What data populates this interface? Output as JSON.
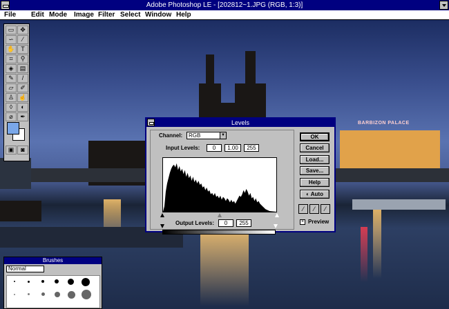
{
  "window": {
    "title": "Adobe Photoshop LE - [202812~1.JPG (RGB, 1:3)]"
  },
  "menu": {
    "items": [
      "File",
      "Edit",
      "Mode",
      "Image",
      "Filter",
      "Select",
      "Window",
      "Help"
    ]
  },
  "photo": {
    "hotel_sign": "BARBIZON PALACE"
  },
  "dialog": {
    "title": "Levels",
    "channel_label": "Channel:",
    "channel_value": "RGB",
    "input_levels_label": "Input Levels:",
    "input_black": "0",
    "input_gamma": "1.00",
    "input_white": "255",
    "output_levels_label": "Output Levels:",
    "output_black": "0",
    "output_white": "255",
    "buttons": {
      "ok": "OK",
      "cancel": "Cancel",
      "load": "Load...",
      "save": "Save...",
      "help": "Help",
      "auto": "Auto"
    },
    "preview_label": "Preview",
    "preview_checked": true
  },
  "brushes": {
    "title": "Brushes",
    "mode": "Normal"
  },
  "colors": {
    "titlebar": "#000080",
    "foreground": "#7aa7e8",
    "background": "#ffffff"
  }
}
